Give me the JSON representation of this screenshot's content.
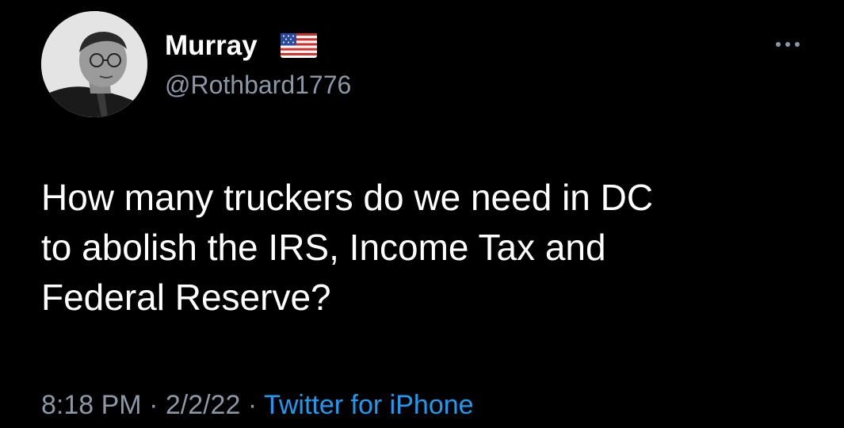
{
  "tweet": {
    "author": {
      "display_name": "Murray",
      "handle": "@Rothbard1776",
      "avatar": "avatar-photo",
      "name_emoji": "us-flag-icon"
    },
    "more_icon": "more-horizontal-icon",
    "text": "How many truckers do we need in DC\nto abolish the IRS, Income Tax and\nFederal Reserve?",
    "time": "8:18 PM",
    "separator1": " · ",
    "date": "2/2/22",
    "separator2": " · ",
    "source": "Twitter for iPhone"
  },
  "colors": {
    "background": "#000000",
    "primary_text": "#ffffff",
    "secondary_text": "#8b98a5",
    "link": "#1d9bf0"
  }
}
